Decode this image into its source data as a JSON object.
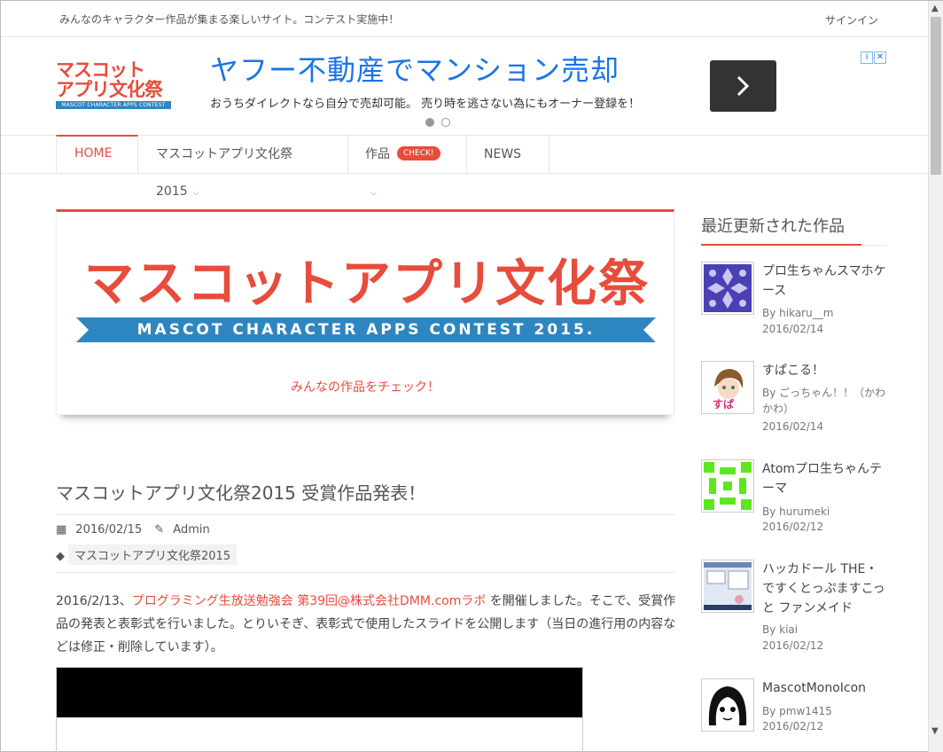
{
  "topbar": {
    "tagline": "みんなのキャラクター作品が集まる楽しいサイト。コンテスト実施中！",
    "signin": "サインイン"
  },
  "logo": {
    "line1": "マスコット",
    "line2": "アプリ文化祭",
    "line3": "MASCOT CHARACTER APPS CONTEST"
  },
  "ad": {
    "title": "ヤフー不動産でマンション売却",
    "description": "おうちダイレクトなら自分で売却可能。 売り時を逃さない為にもオーナー登録を！",
    "arrow_icon": "chevron-right-icon",
    "adchoices_icon": "info-icon",
    "close_icon": "close-icon"
  },
  "nav": {
    "home": "HOME",
    "contest": "マスコットアプリ文化祭2015",
    "works": "作品",
    "works_badge": "CHECK!",
    "news": "NEWS"
  },
  "banner": {
    "big_text": "マスコットアプリ文化祭",
    "ribbon_text": "MASCOT CHARACTER APPS CONTEST 2015.",
    "check_link": "みんなの作品をチェック！"
  },
  "post": {
    "title": "マスコットアプリ文化祭2015 受賞作品発表！",
    "date": "2016/02/15",
    "author": "Admin",
    "tag": "マスコットアプリ文化祭2015",
    "body_prefix": "2016/2/13、",
    "body_link": "プログラミング生放送勉強会 第39回@株式会社DMM.comラボ",
    "body_rest": " を開催しました。そこで、受賞作品の発表と表彰式を行いました。とりいそぎ、表彰式で使用したスライドを公開します（当日の進行用の内容などは修正・削除しています）。"
  },
  "sidebar": {
    "heading": "最近更新された作品",
    "works": [
      {
        "title": "プロ生ちゃんスマホケース",
        "by": "By hikaru__m",
        "date": "2016/02/14"
      },
      {
        "title": "すぱこる！",
        "by": "By ごっちゃん！！（かわかわ）",
        "date": "2016/02/14"
      },
      {
        "title": "Atomプロ生ちゃんテーマ",
        "by": "By hurumeki",
        "date": "2016/02/12"
      },
      {
        "title": "ハッカドール THE・ですくとっぷますこっと ファンメイド",
        "by": "By kiai",
        "date": "2016/02/12"
      },
      {
        "title": "MascotMonoIcon",
        "by": "By pmw1415",
        "date": "2016/02/12"
      }
    ]
  },
  "colors": {
    "accent": "#e74c3c",
    "ad_blue": "#1a73e8",
    "ribbon_blue": "#2e86c1"
  }
}
